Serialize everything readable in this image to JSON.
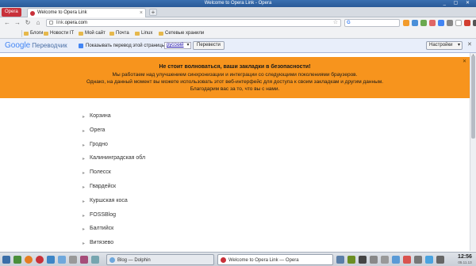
{
  "window": {
    "title": "Welcome to Opera Link - Opera"
  },
  "tabbar": {
    "opera_button": "Opera",
    "tabs": [
      {
        "label": "Welcome to Opera Link"
      }
    ]
  },
  "navbar": {
    "url_host": "link.",
    "url_domain": "opera.com",
    "search_engine": "G"
  },
  "bookmarks": {
    "items": [
      {
        "label": "Блоги"
      },
      {
        "label": "Новости IT"
      },
      {
        "label": "Мой сайт"
      },
      {
        "label": "Почта"
      },
      {
        "label": "Linux"
      },
      {
        "label": "Сетевые хранили"
      }
    ]
  },
  "translate_bar": {
    "logo_google": "Google",
    "logo_translate": "Переводчик",
    "prompt": "Показывать перевод этой страницы на",
    "language": "русский",
    "translate_button": "Перевести",
    "settings_button": "Настройки"
  },
  "banner": {
    "heading": "Не стоит волноваться, ваши закладки в безопасности!",
    "line1": "Мы работаем над улучшением синхронизации и интеграции со следующими поколениями браузеров.",
    "line2": "Однако, на данный момент вы можете использовать этот веб-интерфейс для доступа к своим закладкам и другим данным.",
    "line3": "Благодарим вас за то, что вы с нами."
  },
  "bookmark_folders": [
    "Корзина",
    "Opera",
    "Гродно",
    "Калининградская обл",
    "Полесск",
    "Гвардейск",
    "Куршская коса",
    "FOSSBlog",
    "Балтийск",
    "Витязево"
  ],
  "taskbar": {
    "tasks": [
      {
        "label": "Blog — Dolphin",
        "active": false
      },
      {
        "label": "Welcome to Opera Link — Opera",
        "active": true
      }
    ],
    "clock_time": "12:56",
    "clock_date": "05.11.13"
  },
  "colors": {
    "banner_bg": "#f7941d",
    "opera_red": "#c8313a",
    "translate_bar_bg": "#e8eefa"
  }
}
